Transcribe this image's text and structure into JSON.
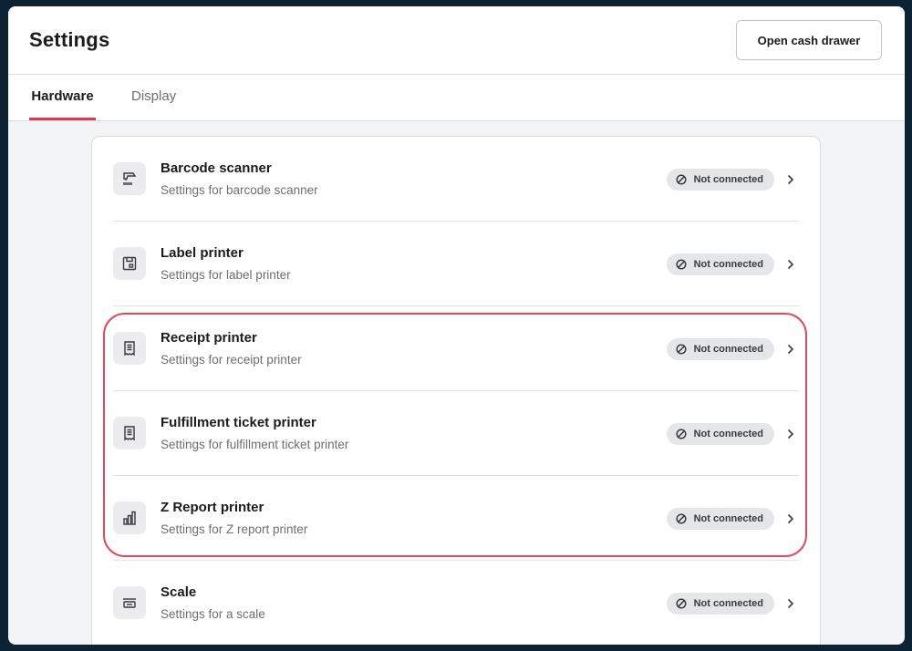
{
  "header": {
    "title": "Settings",
    "cash_drawer_label": "Open cash drawer"
  },
  "tabs": [
    {
      "label": "Hardware",
      "active": true
    },
    {
      "label": "Display",
      "active": false
    }
  ],
  "devices": [
    {
      "title": "Barcode scanner",
      "subtitle": "Settings for barcode scanner",
      "status": "Not connected",
      "icon": "barcode-scanner-icon"
    },
    {
      "title": "Label printer",
      "subtitle": "Settings for label printer",
      "status": "Not connected",
      "icon": "label-printer-icon"
    },
    {
      "title": "Receipt printer",
      "subtitle": "Settings for receipt printer",
      "status": "Not connected",
      "icon": "receipt-icon"
    },
    {
      "title": "Fulfillment ticket printer",
      "subtitle": "Settings for fulfillment ticket printer",
      "status": "Not connected",
      "icon": "ticket-icon"
    },
    {
      "title": "Z Report printer",
      "subtitle": "Settings for Z report printer",
      "status": "Not connected",
      "icon": "bar-chart-icon"
    },
    {
      "title": "Scale",
      "subtitle": "Settings for a scale",
      "status": "Not connected",
      "icon": "scale-icon"
    }
  ],
  "colors": {
    "accent": "#d8394e",
    "highlight": "#e04a5f",
    "badge_bg": "#e5e6e8"
  }
}
